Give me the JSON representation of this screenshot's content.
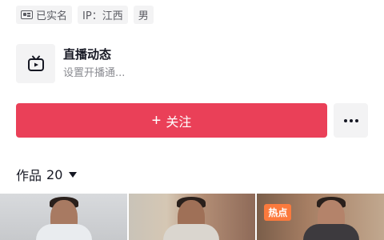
{
  "profile": {
    "tags": [
      {
        "icon": "id-card-icon",
        "label": "已实名"
      },
      {
        "label": "IP：江西"
      },
      {
        "label": "男"
      }
    ]
  },
  "live": {
    "icon": "tv-icon",
    "title": "直播动态",
    "subtitle": "设置开播通..."
  },
  "actions": {
    "follow_label": "关注",
    "more_icon": "more-dots-icon"
  },
  "works": {
    "label": "作品",
    "count": "20"
  },
  "thumbnails": [
    {
      "badge": ""
    },
    {
      "badge": ""
    },
    {
      "badge": "热点"
    }
  ],
  "colors": {
    "accent": "#ea4058",
    "tag_bg": "#f3f3f4",
    "hot_badge": "#fb7a3d"
  }
}
